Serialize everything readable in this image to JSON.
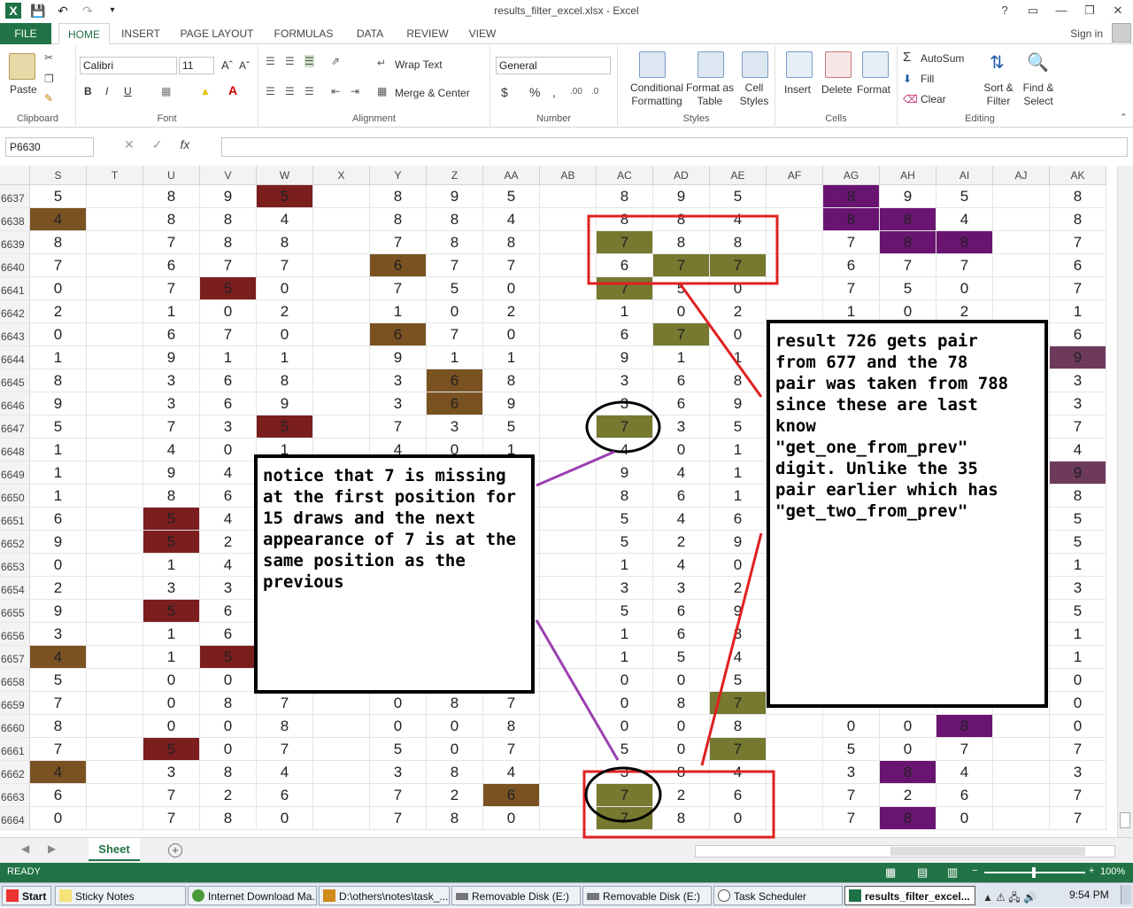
{
  "window": {
    "title": "results_filter_excel.xlsx - Excel",
    "signin": "Sign in",
    "help": "?"
  },
  "tabs": [
    "FILE",
    "HOME",
    "INSERT",
    "PAGE LAYOUT",
    "FORMULAS",
    "DATA",
    "REVIEW",
    "VIEW"
  ],
  "ribbon": {
    "clipboard": {
      "paste": "Paste",
      "label": "Clipboard"
    },
    "font": {
      "name": "Calibri",
      "size": "11",
      "label": "Font",
      "bold": "B",
      "italic": "I",
      "underline": "U"
    },
    "alignment": {
      "wrap": "Wrap Text",
      "merge": "Merge & Center",
      "label": "Alignment"
    },
    "number": {
      "format": "General",
      "label": "Number",
      "currency": "$",
      "percent": "%",
      "comma": ","
    },
    "styles": {
      "conditional": "Conditional Formatting",
      "format_table": "Format as Table",
      "cell_styles": "Cell Styles",
      "label": "Styles"
    },
    "cells": {
      "insert": "Insert",
      "delete": "Delete",
      "format": "Format",
      "label": "Cells"
    },
    "editing": {
      "autosum": "AutoSum",
      "fill": "Fill",
      "clear": "Clear",
      "sort": "Sort & Filter",
      "find": "Find & Select",
      "label": "Editing"
    }
  },
  "formula_bar": {
    "name_box": "P6630",
    "fx": "fx",
    "cancel": "✕",
    "enter": "✓",
    "value": ""
  },
  "columns": [
    "S",
    "T",
    "U",
    "V",
    "W",
    "X",
    "Y",
    "Z",
    "AA",
    "AB",
    "AC",
    "AD",
    "AE",
    "AF",
    "AG",
    "AH",
    "AI",
    "AJ",
    "AK"
  ],
  "rows": [
    {
      "n": "6637",
      "c": [
        "5",
        "",
        "8",
        "9",
        "5",
        "",
        "8",
        "9",
        "5",
        "",
        "8",
        "9",
        "5",
        "",
        "8",
        "9",
        "5",
        "",
        "8"
      ]
    },
    {
      "n": "6638",
      "c": [
        "4",
        "",
        "8",
        "8",
        "4",
        "",
        "8",
        "8",
        "4",
        "",
        "8",
        "8",
        "4",
        "",
        "8",
        "8",
        "4",
        "",
        "8"
      ]
    },
    {
      "n": "6639",
      "c": [
        "8",
        "",
        "7",
        "8",
        "8",
        "",
        "7",
        "8",
        "8",
        "",
        "7",
        "8",
        "8",
        "",
        "7",
        "8",
        "8",
        "",
        "7"
      ]
    },
    {
      "n": "6640",
      "c": [
        "7",
        "",
        "6",
        "7",
        "7",
        "",
        "6",
        "7",
        "7",
        "",
        "6",
        "7",
        "7",
        "",
        "6",
        "7",
        "7",
        "",
        "6"
      ]
    },
    {
      "n": "6641",
      "c": [
        "0",
        "",
        "7",
        "5",
        "0",
        "",
        "7",
        "5",
        "0",
        "",
        "7",
        "5",
        "0",
        "",
        "7",
        "5",
        "0",
        "",
        "7"
      ]
    },
    {
      "n": "6642",
      "c": [
        "2",
        "",
        "1",
        "0",
        "2",
        "",
        "1",
        "0",
        "2",
        "",
        "1",
        "0",
        "2",
        "",
        "1",
        "0",
        "2",
        "",
        "1"
      ]
    },
    {
      "n": "6643",
      "c": [
        "0",
        "",
        "6",
        "7",
        "0",
        "",
        "6",
        "7",
        "0",
        "",
        "6",
        "7",
        "0",
        "",
        "",
        "",
        "",
        "",
        "6"
      ]
    },
    {
      "n": "6644",
      "c": [
        "1",
        "",
        "9",
        "1",
        "1",
        "",
        "9",
        "1",
        "1",
        "",
        "9",
        "1",
        "1",
        "",
        "",
        "",
        "",
        "",
        "9"
      ]
    },
    {
      "n": "6645",
      "c": [
        "8",
        "",
        "3",
        "6",
        "8",
        "",
        "3",
        "6",
        "8",
        "",
        "3",
        "6",
        "8",
        "",
        "",
        "",
        "",
        "",
        "3"
      ]
    },
    {
      "n": "6646",
      "c": [
        "9",
        "",
        "3",
        "6",
        "9",
        "",
        "3",
        "6",
        "9",
        "",
        "3",
        "6",
        "9",
        "",
        "",
        "",
        "",
        "",
        "3"
      ]
    },
    {
      "n": "6647",
      "c": [
        "5",
        "",
        "7",
        "3",
        "5",
        "",
        "7",
        "3",
        "5",
        "",
        "7",
        "3",
        "5",
        "",
        "",
        "",
        "",
        "",
        "7"
      ]
    },
    {
      "n": "6648",
      "c": [
        "1",
        "",
        "4",
        "0",
        "1",
        "",
        "4",
        "0",
        "1",
        "",
        "4",
        "0",
        "1",
        "",
        "",
        "",
        "",
        "",
        "4"
      ]
    },
    {
      "n": "6649",
      "c": [
        "1",
        "",
        "9",
        "4",
        "",
        "",
        "",
        "",
        "",
        "",
        "9",
        "4",
        "1",
        "",
        "",
        "",
        "",
        "",
        "9"
      ]
    },
    {
      "n": "6650",
      "c": [
        "1",
        "",
        "8",
        "6",
        "",
        "",
        "",
        "",
        "",
        "",
        "8",
        "6",
        "1",
        "",
        "",
        "",
        "",
        "",
        "8"
      ]
    },
    {
      "n": "6651",
      "c": [
        "6",
        "",
        "5",
        "4",
        "",
        "",
        "",
        "",
        "",
        "",
        "5",
        "4",
        "6",
        "",
        "",
        "",
        "",
        "",
        "5"
      ]
    },
    {
      "n": "6652",
      "c": [
        "9",
        "",
        "5",
        "2",
        "",
        "",
        "",
        "",
        "",
        "",
        "5",
        "2",
        "9",
        "",
        "",
        "",
        "",
        "",
        "5"
      ]
    },
    {
      "n": "6653",
      "c": [
        "0",
        "",
        "1",
        "4",
        "",
        "",
        "",
        "",
        "",
        "",
        "1",
        "4",
        "0",
        "",
        "",
        "",
        "",
        "",
        "1"
      ]
    },
    {
      "n": "6654",
      "c": [
        "2",
        "",
        "3",
        "3",
        "",
        "",
        "",
        "",
        "",
        "",
        "3",
        "3",
        "2",
        "",
        "",
        "",
        "",
        "",
        "3"
      ]
    },
    {
      "n": "6655",
      "c": [
        "9",
        "",
        "5",
        "6",
        "",
        "",
        "",
        "",
        "",
        "",
        "5",
        "6",
        "9",
        "",
        "",
        "",
        "",
        "",
        "5"
      ]
    },
    {
      "n": "6656",
      "c": [
        "3",
        "",
        "1",
        "6",
        "",
        "",
        "",
        "",
        "",
        "",
        "1",
        "6",
        "3",
        "",
        "",
        "",
        "",
        "",
        "1"
      ]
    },
    {
      "n": "6657",
      "c": [
        "4",
        "",
        "1",
        "5",
        "",
        "",
        "",
        "",
        "",
        "",
        "1",
        "5",
        "4",
        "",
        "",
        "",
        "",
        "",
        "1"
      ]
    },
    {
      "n": "6658",
      "c": [
        "5",
        "",
        "0",
        "0",
        "",
        "",
        "",
        "",
        "",
        "",
        "0",
        "0",
        "5",
        "",
        "",
        "",
        "",
        "",
        "0"
      ]
    },
    {
      "n": "6659",
      "c": [
        "7",
        "",
        "0",
        "8",
        "7",
        "",
        "0",
        "8",
        "7",
        "",
        "0",
        "8",
        "7",
        "",
        "",
        "",
        "",
        "",
        "0"
      ]
    },
    {
      "n": "6660",
      "c": [
        "8",
        "",
        "0",
        "0",
        "8",
        "",
        "0",
        "0",
        "8",
        "",
        "0",
        "0",
        "8",
        "",
        "0",
        "0",
        "8",
        "",
        "0"
      ]
    },
    {
      "n": "6661",
      "c": [
        "7",
        "",
        "5",
        "0",
        "7",
        "",
        "5",
        "0",
        "7",
        "",
        "5",
        "0",
        "7",
        "",
        "5",
        "0",
        "7",
        "",
        "7"
      ]
    },
    {
      "n": "6662",
      "c": [
        "4",
        "",
        "3",
        "8",
        "4",
        "",
        "3",
        "8",
        "4",
        "",
        "3",
        "8",
        "4",
        "",
        "3",
        "8",
        "4",
        "",
        "3"
      ]
    },
    {
      "n": "6663",
      "c": [
        "6",
        "",
        "7",
        "2",
        "6",
        "",
        "7",
        "2",
        "6",
        "",
        "7",
        "2",
        "6",
        "",
        "7",
        "2",
        "6",
        "",
        "7"
      ]
    },
    {
      "n": "6664",
      "c": [
        "0",
        "",
        "7",
        "8",
        "0",
        "",
        "7",
        "8",
        "0",
        "",
        "7",
        "8",
        "0",
        "",
        "7",
        "8",
        "0",
        "",
        "7"
      ]
    }
  ],
  "highlights": {
    "dark_red": "#7b1e1e",
    "brown": "#7a5222",
    "olive": "#76792f",
    "purple": "#6a1472",
    "mauve": "#6d3a5c",
    "cells": [
      {
        "r": 0,
        "c": 4,
        "k": "dark_red"
      },
      {
        "r": 0,
        "c": 14,
        "k": "purple"
      },
      {
        "r": 1,
        "c": 0,
        "k": "brown"
      },
      {
        "r": 1,
        "c": 14,
        "k": "purple"
      },
      {
        "r": 1,
        "c": 15,
        "k": "purple"
      },
      {
        "r": 2,
        "c": 10,
        "k": "olive"
      },
      {
        "r": 2,
        "c": 15,
        "k": "purple"
      },
      {
        "r": 2,
        "c": 16,
        "k": "purple"
      },
      {
        "r": 3,
        "c": 6,
        "k": "brown"
      },
      {
        "r": 3,
        "c": 11,
        "k": "olive"
      },
      {
        "r": 3,
        "c": 12,
        "k": "olive"
      },
      {
        "r": 4,
        "c": 3,
        "k": "dark_red"
      },
      {
        "r": 4,
        "c": 10,
        "k": "olive"
      },
      {
        "r": 6,
        "c": 6,
        "k": "brown"
      },
      {
        "r": 6,
        "c": 11,
        "k": "olive"
      },
      {
        "r": 7,
        "c": 18,
        "k": "mauve"
      },
      {
        "r": 8,
        "c": 7,
        "k": "brown"
      },
      {
        "r": 9,
        "c": 7,
        "k": "brown"
      },
      {
        "r": 10,
        "c": 4,
        "k": "dark_red"
      },
      {
        "r": 10,
        "c": 10,
        "k": "olive"
      },
      {
        "r": 12,
        "c": 18,
        "k": "mauve"
      },
      {
        "r": 14,
        "c": 2,
        "k": "dark_red"
      },
      {
        "r": 15,
        "c": 2,
        "k": "dark_red"
      },
      {
        "r": 18,
        "c": 2,
        "k": "dark_red"
      },
      {
        "r": 20,
        "c": 0,
        "k": "brown"
      },
      {
        "r": 20,
        "c": 3,
        "k": "dark_red"
      },
      {
        "r": 22,
        "c": 12,
        "k": "olive"
      },
      {
        "r": 23,
        "c": 16,
        "k": "purple"
      },
      {
        "r": 24,
        "c": 2,
        "k": "dark_red"
      },
      {
        "r": 24,
        "c": 12,
        "k": "olive"
      },
      {
        "r": 25,
        "c": 0,
        "k": "brown"
      },
      {
        "r": 25,
        "c": 15,
        "k": "purple"
      },
      {
        "r": 26,
        "c": 8,
        "k": "brown"
      },
      {
        "r": 26,
        "c": 10,
        "k": "olive"
      },
      {
        "r": 27,
        "c": 10,
        "k": "olive"
      },
      {
        "r": 27,
        "c": 15,
        "k": "purple"
      }
    ]
  },
  "annotations": {
    "left": "notice that 7 is missing\nat the first position for\n15 draws and the next\nappearance of 7 is at the\nsame position as the\nprevious",
    "right": "result 726 gets pair\nfrom 677 and the 78\npair was taken from 788\nsince these are last\nknow\n\"get_one_from_prev\"\ndigit. Unlike the 35\npair earlier which has\n\"get_two_from_prev\""
  },
  "sheet": {
    "name": "Sheet",
    "add": "+"
  },
  "status": {
    "ready": "READY",
    "zoom": "100%",
    "minus": "−",
    "plus": "+"
  },
  "taskbar": {
    "start": "Start",
    "items": [
      "Sticky Notes",
      "Internet Download Ma...",
      "D:\\others\\notes\\task_...",
      "Removable Disk (E:)",
      "Removable Disk (E:)",
      "Task Scheduler",
      "results_filter_excel..."
    ],
    "time": "9:54 PM"
  }
}
